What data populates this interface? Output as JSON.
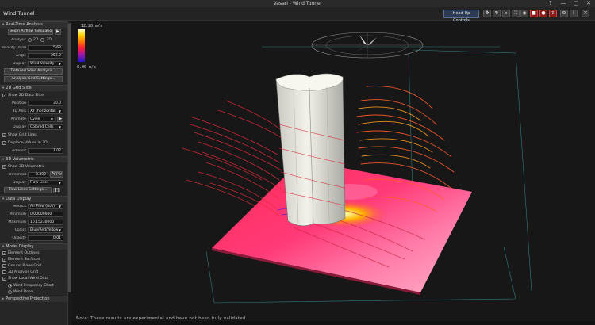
{
  "window": {
    "title": "Vasari - Wind Tunnel",
    "controls": [
      "?",
      "—",
      "▢",
      "✕"
    ]
  },
  "toolbar": {
    "app_title": "Wind Tunnel",
    "hud_label": "Head-Up Controls"
  },
  "panel": {
    "realtime": {
      "header": "Real-Time Analysis",
      "begin_label": "Begin Airflow Simulatio",
      "analysis_label": "Analysis",
      "opt_2d": "2D",
      "opt_3d": "3D",
      "analysis_selected": "3D",
      "velocity_label": "Velocity (m/s)",
      "velocity_value": "5.63",
      "angle_label": "Angle",
      "angle_value": "255.0",
      "display_label": "Display",
      "display_value": "Wind Velocity",
      "detailed_btn": "Detailed Wind Analysis...",
      "grid_btn": "Analysis Grid Settings..."
    },
    "grid_slice": {
      "header": "2D Grid Slice",
      "show_label": "Show 2D Data Slice",
      "show_checked": true,
      "position_label": "Position",
      "position_value": "30.0",
      "axis_label": "3D Axis",
      "axis_value": "XY (horizontal)",
      "animate_label": "Animate",
      "animate_value": "Cycle",
      "display_label": "Display",
      "display_value": "Colored Cells",
      "gridlines_label": "Show Grid Lines",
      "gridlines_checked": true,
      "displace_label": "Displace Values in 3D",
      "displace_checked": true,
      "amount_label": "Amount",
      "amount_value": "1.02"
    },
    "volumetric": {
      "header": "3D Volumetric",
      "show_label": "Show 3D Volumetric",
      "show_checked": true,
      "threshold_label": "Threshold",
      "threshold_value": "0.300",
      "apply_label": "Apply",
      "display_label": "Display",
      "display_value": "Flow Lines",
      "settings_btn": "Flow Lines Settings..."
    },
    "data_display": {
      "header": "Data Display",
      "metrics_label": "Metrics",
      "metrics_value": "Air Flow (m/s)",
      "minimum_label": "Minimum",
      "minimum_value": "0.00000000",
      "maximum_label": "Maximum",
      "maximum_value": "10.15230000",
      "colors_label": "Colors",
      "colors_value": "Blue/Red/Yellow",
      "opacity_label": "Opacity",
      "opacity_value": "0.01"
    },
    "model_display": {
      "header": "Model Display",
      "items": [
        {
          "label": "Element Outlines",
          "checked": true
        },
        {
          "label": "Element Surfaces",
          "checked": true
        },
        {
          "label": "Ground Plane Grid",
          "checked": true
        },
        {
          "label": "3D Analysis Grid",
          "checked": false
        }
      ]
    },
    "local_wind": {
      "show_label": "Show Local Wind Data",
      "show_checked": true,
      "opt_freq": "Wind Frequency Chart",
      "opt_rose": "Wind Rose",
      "selected": "Wind Frequency Chart"
    },
    "perspective_header": "Perspective Projection"
  },
  "legend": {
    "max_label": "12.28 m/s",
    "min_label": "0.00 m/s"
  },
  "viewport": {
    "note": "Note: These results are experimental and have not been fully validated."
  }
}
